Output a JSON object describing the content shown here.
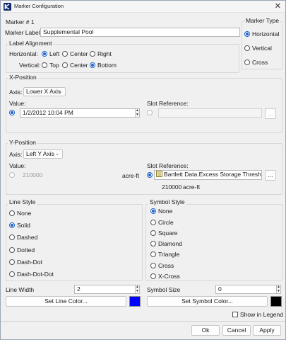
{
  "window": {
    "title": "Marker Configuration",
    "close_glyph": "✕"
  },
  "marker": {
    "number_label": "Marker # 1",
    "label_caption": "Marker Label",
    "label_value": "Supplemental Pool"
  },
  "alignment": {
    "group_title": "Label Alignment",
    "horizontal_caption": "Horizontal:",
    "horizontal_options": [
      "Left",
      "Center",
      "Right"
    ],
    "vertical_caption": "Vertical:",
    "vertical_options": [
      "Top",
      "Center",
      "Bottom"
    ]
  },
  "marker_type": {
    "group_title": "Marker Type",
    "options": [
      "Horizontal",
      "Vertical",
      "Cross"
    ]
  },
  "x_position": {
    "group_title": "X-Position",
    "axis_caption": "Axis:",
    "axis_value": "Lower X Axis",
    "value_caption": "Value:",
    "value": "1/2/2012 10:04 PM",
    "slot_caption": "Slot Reference:",
    "browse_label": "..."
  },
  "y_position": {
    "group_title": "Y-Position",
    "axis_caption": "Axis:",
    "axis_value": "Left Y Axis",
    "value_caption": "Value:",
    "value": "210000",
    "value_unit": "acre-ft",
    "slot_caption": "Slot Reference:",
    "slot_value": "Bartlett Data.Excess Storage Threshold",
    "slot_readout": "210000",
    "slot_readout_unit": "acre-ft",
    "browse_label": "..."
  },
  "line_style": {
    "group_title": "Line Style",
    "options": [
      "None",
      "Solid",
      "Dashed",
      "Dotted",
      "Dash-Dot",
      "Dash-Dot-Dot"
    ],
    "width_caption": "Line Width",
    "width_value": "2",
    "color_button": "Set Line Color...",
    "color": "#0000ff"
  },
  "symbol_style": {
    "group_title": "Symbol Style",
    "options": [
      "None",
      "Circle",
      "Square",
      "Diamond",
      "Triangle",
      "Cross",
      "X-Cross"
    ],
    "size_caption": "Symbol Size",
    "size_value": "0",
    "color_button": "Set Symbol Color...",
    "color": "#000000"
  },
  "legend_checkbox": "Show in Legend",
  "footer": {
    "ok": "Ok",
    "cancel": "Cancel",
    "apply": "Apply"
  },
  "colors": {
    "accent": "#1e63c7",
    "window_bg": "#f0f0f0"
  }
}
